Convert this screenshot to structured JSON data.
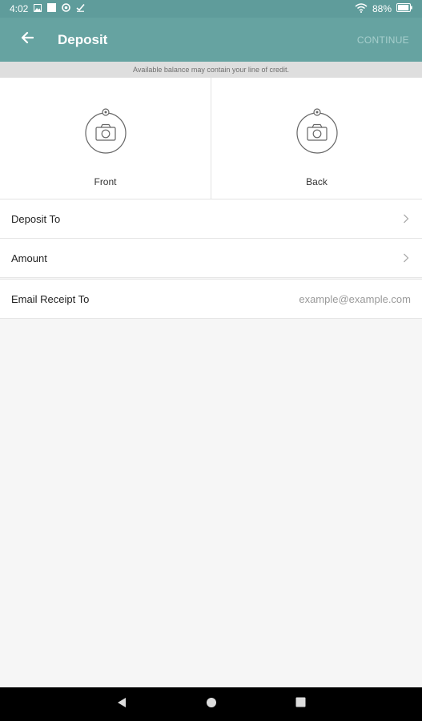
{
  "status_bar": {
    "time": "4:02",
    "battery_percent": "88%",
    "icons": [
      "image-icon",
      "square-icon",
      "circle-record-icon",
      "check-icon",
      "wifi-icon",
      "battery-icon"
    ]
  },
  "app_bar": {
    "title": "Deposit",
    "continue_label": "CONTINUE",
    "back_icon": "arrow-left-icon"
  },
  "banner": {
    "text": "Available balance may contain your line of credit."
  },
  "capture": {
    "front_label": "Front",
    "back_label": "Back",
    "icon": "camera-icon"
  },
  "rows": {
    "deposit_to": {
      "label": "Deposit To"
    },
    "amount": {
      "label": "Amount"
    },
    "email_receipt": {
      "label": "Email Receipt To",
      "placeholder": "example@example.com"
    }
  },
  "nav_bar": {
    "icons": [
      "back-triangle-icon",
      "home-circle-icon",
      "recents-square-icon"
    ]
  },
  "colors": {
    "status_bar": "#5f9c9b",
    "app_bar": "#66a3a1",
    "continue_disabled": "#a7cfcd",
    "background": "#f6f6f6"
  }
}
